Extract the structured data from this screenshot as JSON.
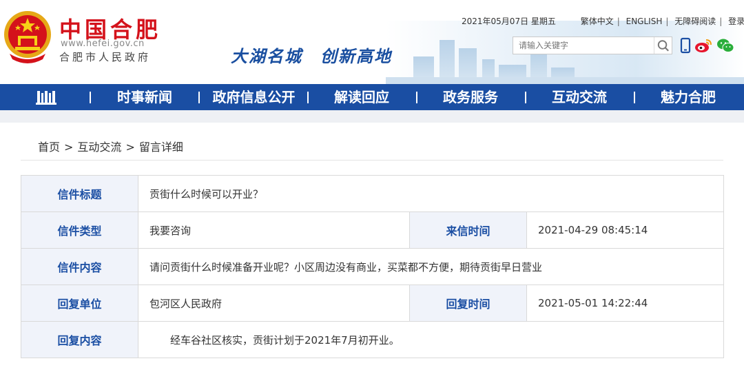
{
  "header": {
    "site_name": "中国合肥",
    "site_url": "www.hefei.gov.cn",
    "site_sub": "合肥市人民政府",
    "slogan": "大湖名城　创新高地"
  },
  "top_links": {
    "date": "2021年05月07日 星期五",
    "traditional": "繁体中文",
    "english": "ENGLISH",
    "accessible": "无障碍阅读",
    "login": "登录"
  },
  "search": {
    "placeholder": "请输入关键字"
  },
  "nav": {
    "items": [
      {
        "label": "时事新闻"
      },
      {
        "label": "政府信息公开"
      },
      {
        "label": "解读回应"
      },
      {
        "label": "政务服务"
      },
      {
        "label": "互动交流"
      },
      {
        "label": "魅力合肥"
      }
    ]
  },
  "breadcrumb": [
    "首页",
    "互动交流",
    "留言详细"
  ],
  "breadcrumb_sep": ">",
  "letter": {
    "title_label": "信件标题",
    "title_value": "贡街什么时候可以开业？",
    "type_label": "信件类型",
    "type_value": "我要咨询",
    "time_label": "来信时间",
    "time_value": "2021-04-29 08:45:14",
    "content_label": "信件内容",
    "content_value": "请问贡街什么时候准备开业呢？小区周边没有商业，买菜都不方便，期待贡街早日营业",
    "reply_unit_label": "回复单位",
    "reply_unit_value": "包河区人民政府",
    "reply_time_label": "回复时间",
    "reply_time_value": "2021-05-01 14:22:44",
    "reply_content_label": "回复内容",
    "reply_content_value": "经车谷社区核实，贡街计划于2021年7月初开业。"
  },
  "colors": {
    "brand_red": "#d4121b",
    "nav_blue": "#1a4ea3",
    "label_bg": "#f0f3fa"
  }
}
